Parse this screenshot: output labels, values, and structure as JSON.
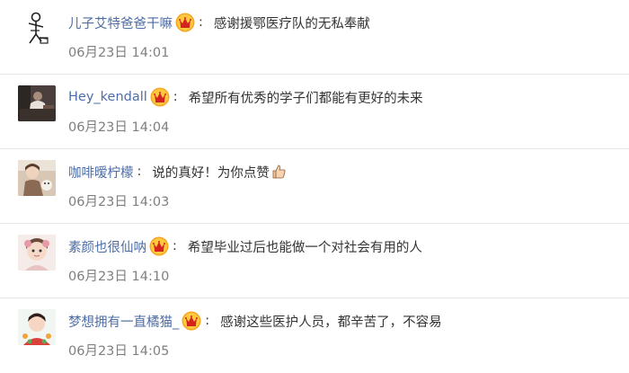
{
  "comments": [
    {
      "username": "儿子艾特爸爸干嘛",
      "avatar": "stick-figure-avatar",
      "text": "感谢援鄂医疗队的无私奉献",
      "time": "06月23日 14:01"
    },
    {
      "username": "Hey_kendall",
      "avatar": "dark-photo-avatar",
      "text": "希望所有优秀的学子们都能有更好的未来",
      "time": "06月23日 14:04"
    },
    {
      "username": "咖啡暧柠檬",
      "avatar": "girl-photo-avatar",
      "text": "说的真好！为你点赞",
      "time": "06月23日 14:03",
      "emoji": "thumbs-up-icon"
    },
    {
      "username": "素颜也很仙呐",
      "avatar": "child-photo-avatar",
      "text": "希望毕业过后也能做一个对社会有用的人",
      "time": "06月23日 14:10"
    },
    {
      "username": "梦想拥有一直橘猫_",
      "avatar": "girl-flowers-avatar",
      "text": "感谢这些医护人员，都辛苦了，不容易",
      "time": "06月23日 14:05"
    }
  ],
  "colors": {
    "username": "#4e6ea5",
    "text": "#333333",
    "time": "#7f7f7f",
    "badge": "#f5a623"
  },
  "badge_icon": "vip-crown-icon"
}
